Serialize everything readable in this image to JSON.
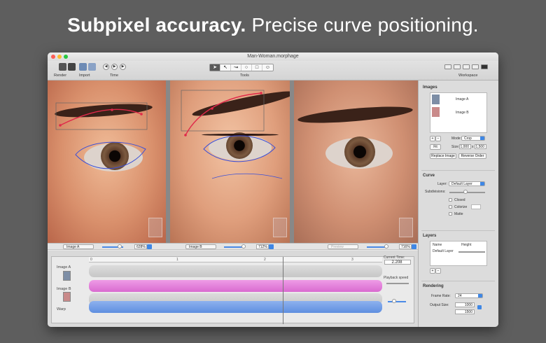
{
  "hero": {
    "bold": "Subpixel accuracy.",
    "light": "Precise curve positioning."
  },
  "window": {
    "title": "Man-Woman.morphage"
  },
  "toolbar": {
    "render_label": "Render",
    "import_label": "Import",
    "time_label": "Time",
    "tools_label": "Tools",
    "workspace_label": "Workspace",
    "play_back": "◀",
    "play": "▶",
    "play_fwd": "▶"
  },
  "panes": {
    "pane1": {
      "image": "Image A",
      "zoom": "628%"
    },
    "pane2": {
      "image": "Image B",
      "zoom": "712%"
    },
    "pane3": {
      "image": "Preview",
      "zoom": "716%"
    }
  },
  "timeline": {
    "ticks": [
      "0",
      "1",
      "2",
      "3"
    ],
    "tracks": [
      {
        "label": "Image A"
      },
      {
        "label": "Image B"
      },
      {
        "label": "Warp"
      }
    ],
    "current_time_label": "Current Time:",
    "current_time": "2.208",
    "playback_speed_label": "Playback speed"
  },
  "images_panel": {
    "title": "Images",
    "items": [
      {
        "label": "Image A"
      },
      {
        "label": "Image B"
      }
    ],
    "mode_label": "Mode:",
    "mode_value": "Crop",
    "fit_label": "Fit",
    "size_label": "Size:",
    "size_w": "1,000",
    "size_x": "x",
    "size_h": "1,500",
    "replace_label": "Replace Image",
    "reverse_label": "Reverse Order",
    "add": "+",
    "remove": "−"
  },
  "curve_panel": {
    "title": "Curve",
    "layer_label": "Layer:",
    "layer_value": "Default Layer",
    "subdiv_label": "Subdivisions:",
    "closed_label": "Closed",
    "colorize_label": "Colorize",
    "matte_label": "Matte"
  },
  "layers_panel": {
    "title": "Layers",
    "col_name": "Name",
    "col_height": "Height",
    "row_name": "Default Layer",
    "add": "+",
    "remove": "−"
  },
  "rendering_panel": {
    "title": "Rendering",
    "frame_rate_label": "Frame Rate:",
    "frame_rate_value": "24",
    "output_size_label": "Output Size:",
    "out_w": "1000",
    "out_h": "1500"
  },
  "colors": {
    "accent": "#3f87e5",
    "track_pink": "#d96bd0",
    "track_blue": "#5f8fe0",
    "curve_red": "#e0294a",
    "curve_blue": "#3a4fd8"
  }
}
